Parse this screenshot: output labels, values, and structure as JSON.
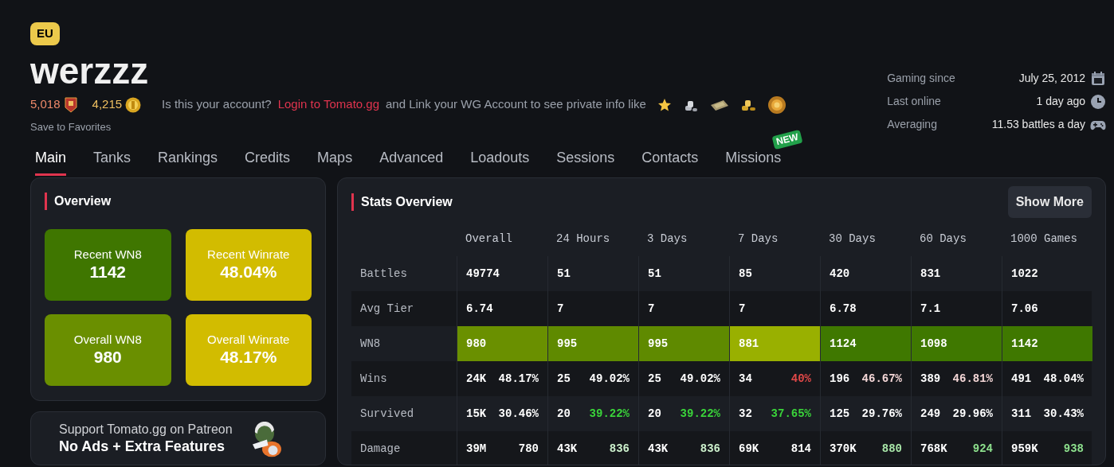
{
  "region": "EU",
  "player": "werzzz",
  "ratings": [
    {
      "kind": "rank",
      "value": "5,018"
    },
    {
      "kind": "gold",
      "value": "4,215"
    }
  ],
  "account_prompt": {
    "before": "Is this your account?",
    "link": "Login to Tomato.gg",
    "after": "and Link your WG Account to see private info like"
  },
  "save_link": "Save to Favorites",
  "info": [
    {
      "kind": "calendar",
      "label": "Gaming since",
      "value": "July 25, 2012"
    },
    {
      "kind": "clock",
      "label": "Last online",
      "value": "1 day ago"
    },
    {
      "kind": "gamepad",
      "label": "Averaging",
      "value": "11.53 battles a day"
    }
  ],
  "tabs": [
    {
      "label": "Main",
      "selected": true
    },
    {
      "label": "Tanks",
      "selected": false
    },
    {
      "label": "Rankings",
      "selected": false
    },
    {
      "label": "Credits",
      "selected": false
    },
    {
      "label": "Maps",
      "selected": false
    },
    {
      "label": "Advanced",
      "selected": false
    },
    {
      "label": "Loadouts",
      "selected": false
    },
    {
      "label": "Sessions",
      "selected": false
    },
    {
      "label": "Contacts",
      "selected": false
    },
    {
      "label": "Missions",
      "selected": false,
      "badge": "NEW"
    }
  ],
  "overview": {
    "title": "Overview",
    "tiles": [
      {
        "label": "Recent WN8",
        "value": "1142",
        "color": "#3f7600"
      },
      {
        "label": "Recent Winrate",
        "value": "48.04%",
        "color": "#d2bc00"
      },
      {
        "label": "Overall WN8",
        "value": "980",
        "color": "#6a8f00"
      },
      {
        "label": "Overall Winrate",
        "value": "48.17%",
        "color": "#d2bc00"
      }
    ]
  },
  "patreon": {
    "line1": "Support Tomato.gg on Patreon",
    "line2": "No Ads + Extra Features"
  },
  "stats": {
    "title": "Stats Overview",
    "button": "Show More",
    "columns": [
      "Overall",
      "24 Hours",
      "3 Days",
      "7 Days",
      "30 Days",
      "60 Days",
      "1000 Games"
    ],
    "rows": [
      {
        "kind": "plain",
        "label": "Battles",
        "cells": [
          {
            "text": "49774"
          },
          {
            "text": "51"
          },
          {
            "text": "51"
          },
          {
            "text": "85"
          },
          {
            "text": "420"
          },
          {
            "text": "831"
          },
          {
            "text": "1022"
          }
        ]
      },
      {
        "kind": "plain",
        "label": "Avg Tier",
        "cells": [
          {
            "text": "6.74"
          },
          {
            "text": "7"
          },
          {
            "text": "7"
          },
          {
            "text": "7"
          },
          {
            "text": "6.78"
          },
          {
            "text": "7.1"
          },
          {
            "text": "7.06"
          }
        ]
      },
      {
        "kind": "rating",
        "label": "WN8",
        "cells": [
          {
            "text": "980",
            "color": "#6a9000"
          },
          {
            "text": "995",
            "color": "#5f8a00"
          },
          {
            "text": "995",
            "color": "#5f8a00"
          },
          {
            "text": "881",
            "color": "#99b000"
          },
          {
            "text": "1124",
            "color": "#3f7800"
          },
          {
            "text": "1098",
            "color": "#3f7800"
          },
          {
            "text": "1142",
            "color": "#3f7800"
          }
        ]
      },
      {
        "kind": "split",
        "label": "Wins",
        "cells": [
          {
            "text": "24K",
            "value": "48.17%",
            "color": "#ffffff"
          },
          {
            "text": "25",
            "value": "49.02%",
            "color": "#ffffff"
          },
          {
            "text": "25",
            "value": "49.02%",
            "color": "#ffffff"
          },
          {
            "text": "34",
            "value": "40%",
            "color": "#e04848"
          },
          {
            "text": "196",
            "value": "46.67%",
            "color": "#f3d6d6"
          },
          {
            "text": "389",
            "value": "46.81%",
            "color": "#f3d6d6"
          },
          {
            "text": "491",
            "value": "48.04%",
            "color": "#ffffff"
          }
        ]
      },
      {
        "kind": "split",
        "label": "Survived",
        "cells": [
          {
            "text": "15K",
            "value": "30.46%",
            "color": "#ffffff"
          },
          {
            "text": "20",
            "value": "39.22%",
            "color": "#3ad43a"
          },
          {
            "text": "20",
            "value": "39.22%",
            "color": "#3ad43a"
          },
          {
            "text": "32",
            "value": "37.65%",
            "color": "#3ad43a"
          },
          {
            "text": "125",
            "value": "29.76%",
            "color": "#ffffff"
          },
          {
            "text": "249",
            "value": "29.96%",
            "color": "#ffffff"
          },
          {
            "text": "311",
            "value": "30.43%",
            "color": "#ffffff"
          }
        ]
      },
      {
        "kind": "split",
        "label": "Damage",
        "cells": [
          {
            "text": "39M",
            "value": "780",
            "color": "#ffffff"
          },
          {
            "text": "43K",
            "value": "836",
            "color": "#ccf0cc"
          },
          {
            "text": "43K",
            "value": "836",
            "color": "#ccf0cc"
          },
          {
            "text": "69K",
            "value": "814",
            "color": "#ffffff"
          },
          {
            "text": "370K",
            "value": "880",
            "color": "#a8e6a8"
          },
          {
            "text": "768K",
            "value": "924",
            "color": "#8de08d"
          },
          {
            "text": "959K",
            "value": "938",
            "color": "#8de08d"
          }
        ]
      }
    ]
  }
}
